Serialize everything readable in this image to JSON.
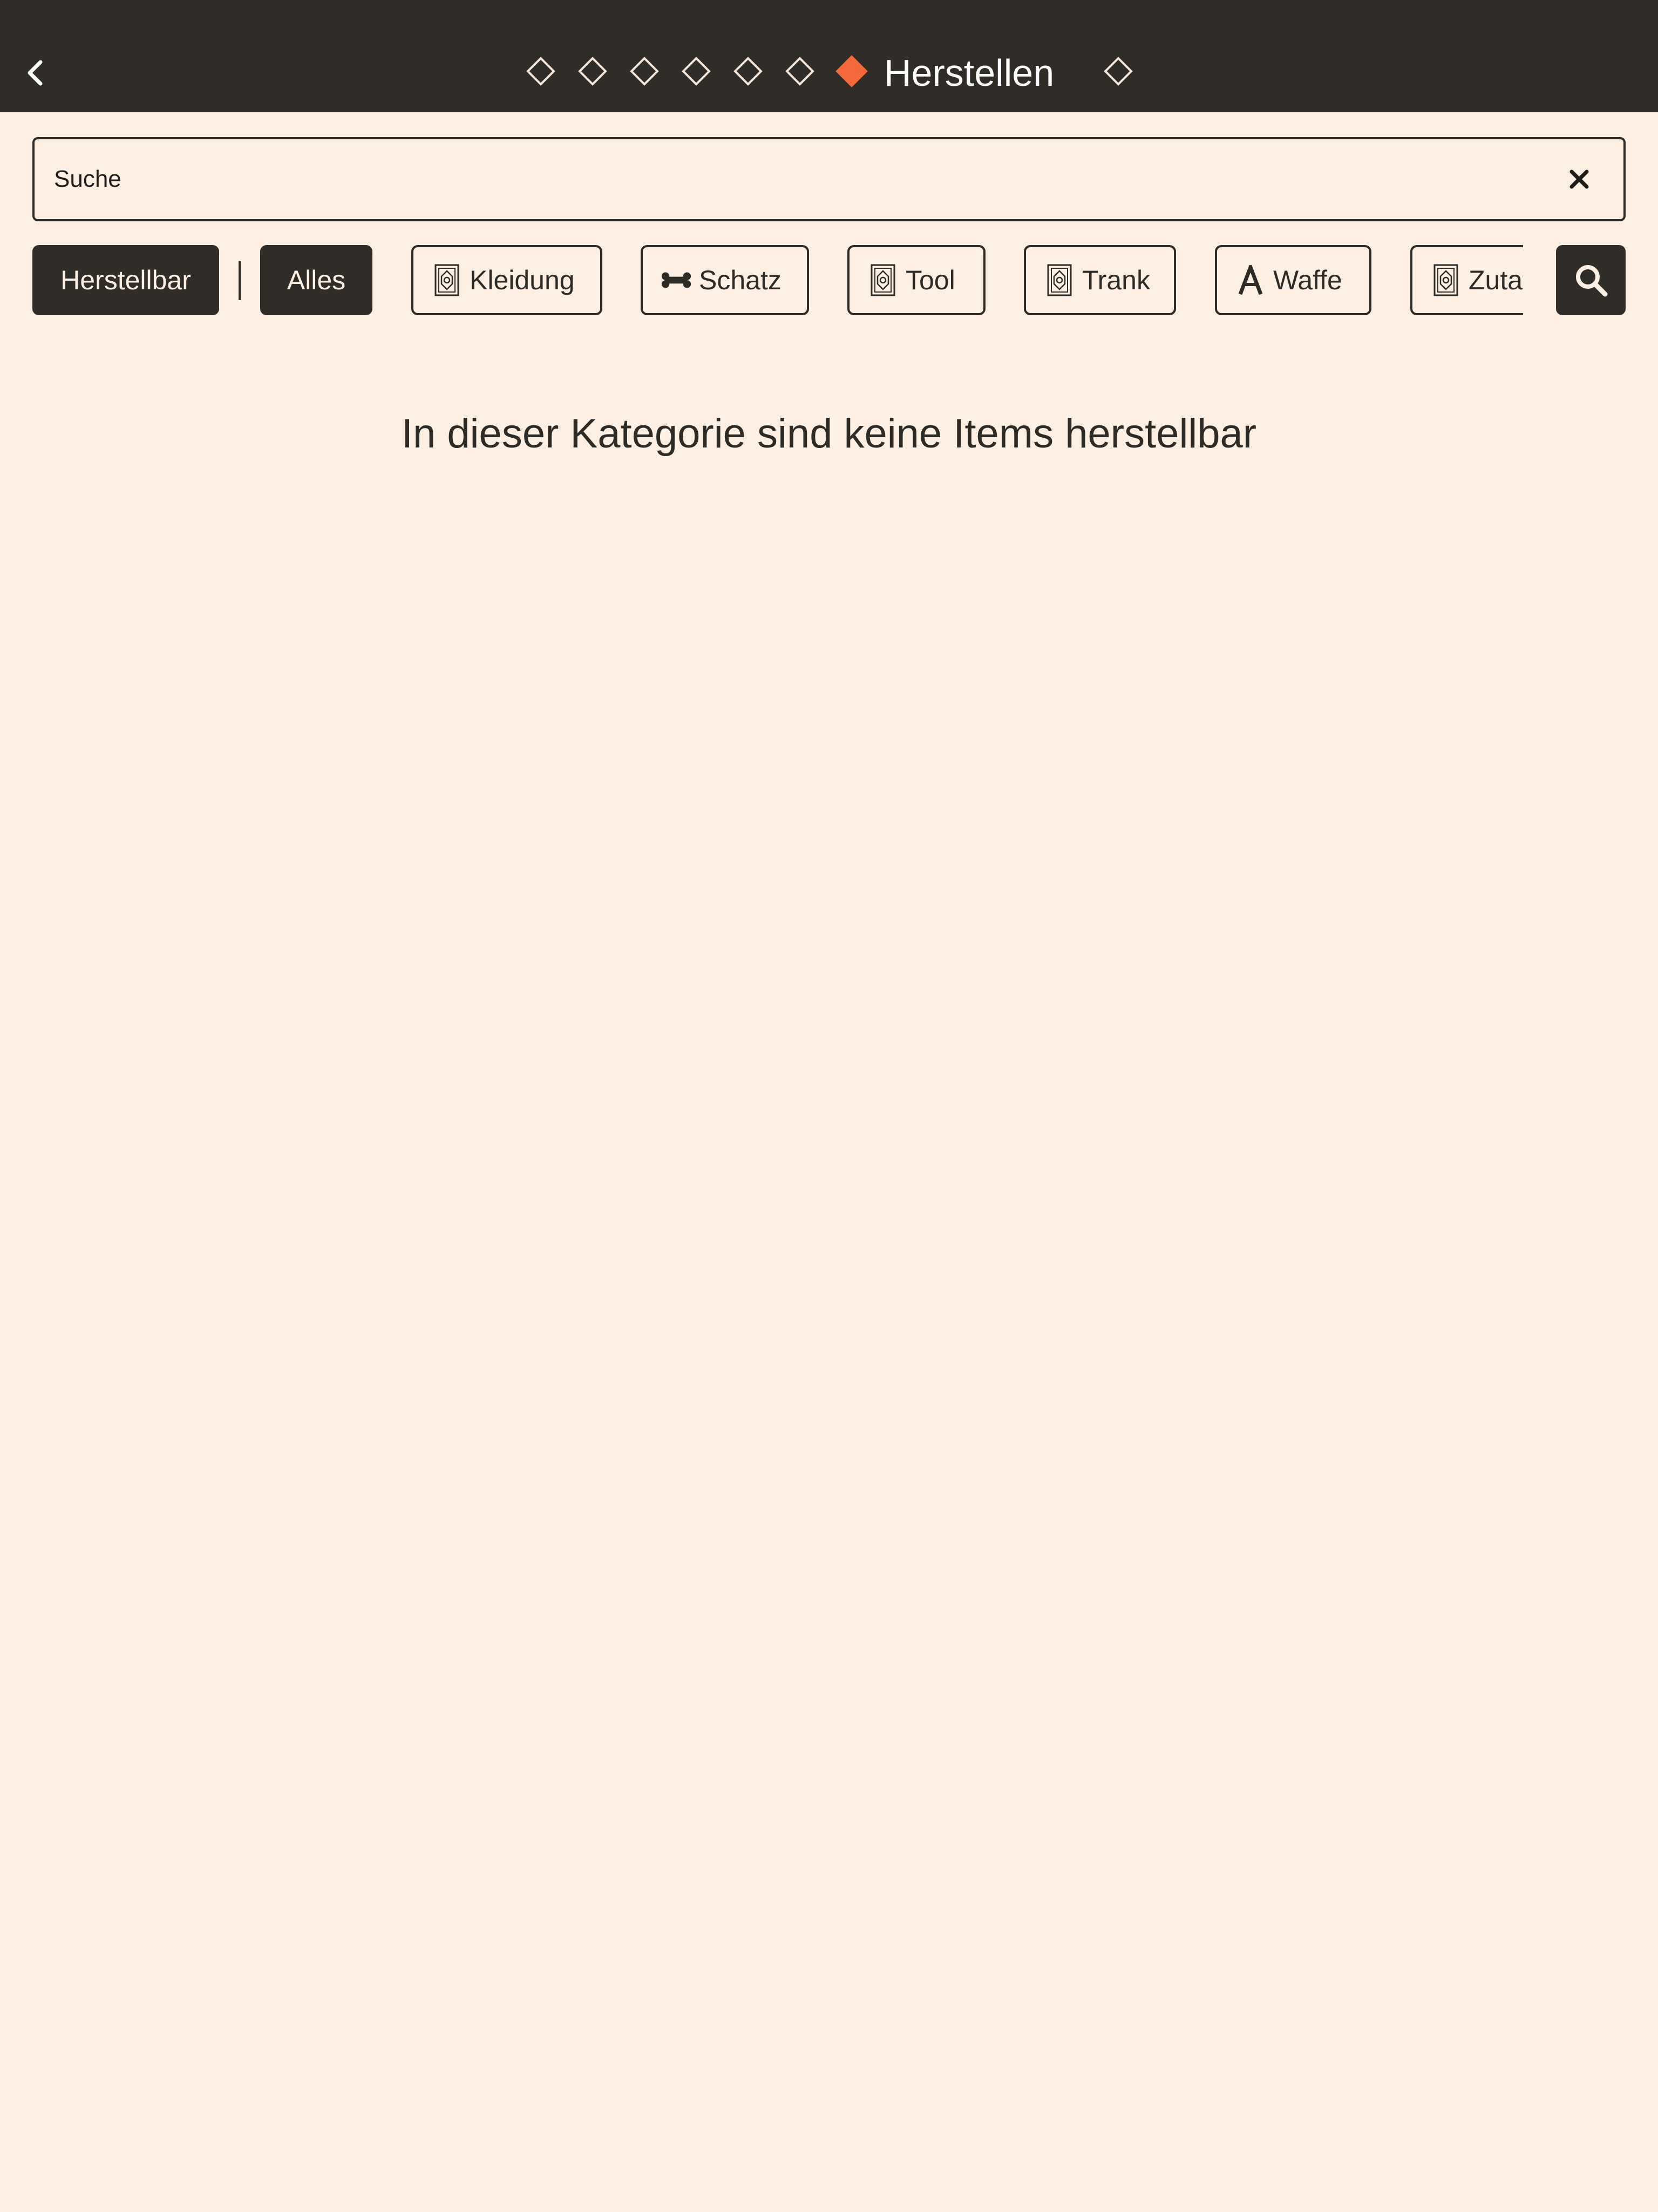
{
  "header": {
    "title": "Herstellen",
    "back_icon": "chevron-left-icon",
    "page_indicator": {
      "total": 8,
      "active_index": 6
    }
  },
  "search": {
    "placeholder": "Suche",
    "value": "",
    "clear_icon": "close-icon"
  },
  "filters": {
    "craftable_label": "Herstellbar",
    "chips": [
      {
        "label": "Alles",
        "icon": null,
        "selected": true
      },
      {
        "label": "Kleidung",
        "icon": "emblem-icon",
        "selected": false
      },
      {
        "label": "Schatz",
        "icon": "bone-icon",
        "selected": false
      },
      {
        "label": "Tool",
        "icon": "emblem-icon",
        "selected": false
      },
      {
        "label": "Trank",
        "icon": "emblem-icon",
        "selected": false
      },
      {
        "label": "Waffe",
        "icon": "letter-a-icon",
        "selected": false
      },
      {
        "label": "Zutat",
        "icon": "emblem-icon",
        "selected": false
      }
    ],
    "search_icon": "search-icon"
  },
  "content": {
    "empty_message": "In dieser Kategorie sind keine Items herstellbar"
  },
  "colors": {
    "background": "#fdf0e3",
    "header": "#302c28",
    "accent": "#f2683a",
    "text": "#2e2b27"
  }
}
